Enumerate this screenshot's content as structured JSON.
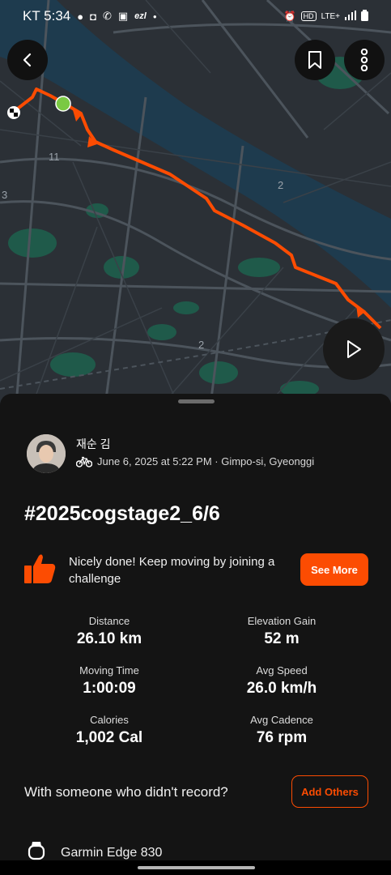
{
  "status_bar": {
    "carrier_time": "KT 5:34",
    "left_icons": [
      "talk-icon",
      "instagram-icon",
      "phone-icon",
      "gallery-icon"
    ],
    "app_badge": "ezl",
    "right_icons": [
      "alarm-icon",
      "hd-icon",
      "signal-icon",
      "battery-icon"
    ],
    "network": "LTE+"
  },
  "map": {
    "labels": [
      "11",
      "2",
      "2",
      "3"
    ],
    "route_color": "#fc4c02",
    "start_marker_color": "#7ac943"
  },
  "actions": {
    "back_icon": "chevron-left-icon",
    "bookmark_icon": "bookmark-icon",
    "more_icon": "more-vertical-icon",
    "play_icon": "play-icon"
  },
  "activity": {
    "athlete_name": "재순 김",
    "date_location": "June 6, 2025 at 5:22 PM · Gimpo-si, Gyeonggi",
    "sport_icon": "bike-icon",
    "title": "#2025cogstage2_6/6"
  },
  "challenge": {
    "text": "Nicely done! Keep moving by joining a challenge",
    "button": "See More",
    "icon": "thumbs-up-icon"
  },
  "stats": [
    {
      "label": "Distance",
      "value": "26.10 km"
    },
    {
      "label": "Elevation Gain",
      "value": "52 m"
    },
    {
      "label": "Moving Time",
      "value": "1:00:09"
    },
    {
      "label": "Avg Speed",
      "value": "26.0 km/h"
    },
    {
      "label": "Calories",
      "value": "1,002 Cal"
    },
    {
      "label": "Avg Cadence",
      "value": "76 rpm"
    }
  ],
  "record": {
    "question": "With someone who didn't record?",
    "button": "Add Others"
  },
  "device": {
    "name": "Garmin Edge 830",
    "icon": "watch-icon"
  },
  "colors": {
    "accent": "#fc4c02",
    "background": "#141414",
    "map_base": "#2b3036",
    "map_water": "#1e3b4e",
    "map_park": "#1f5a4a"
  }
}
